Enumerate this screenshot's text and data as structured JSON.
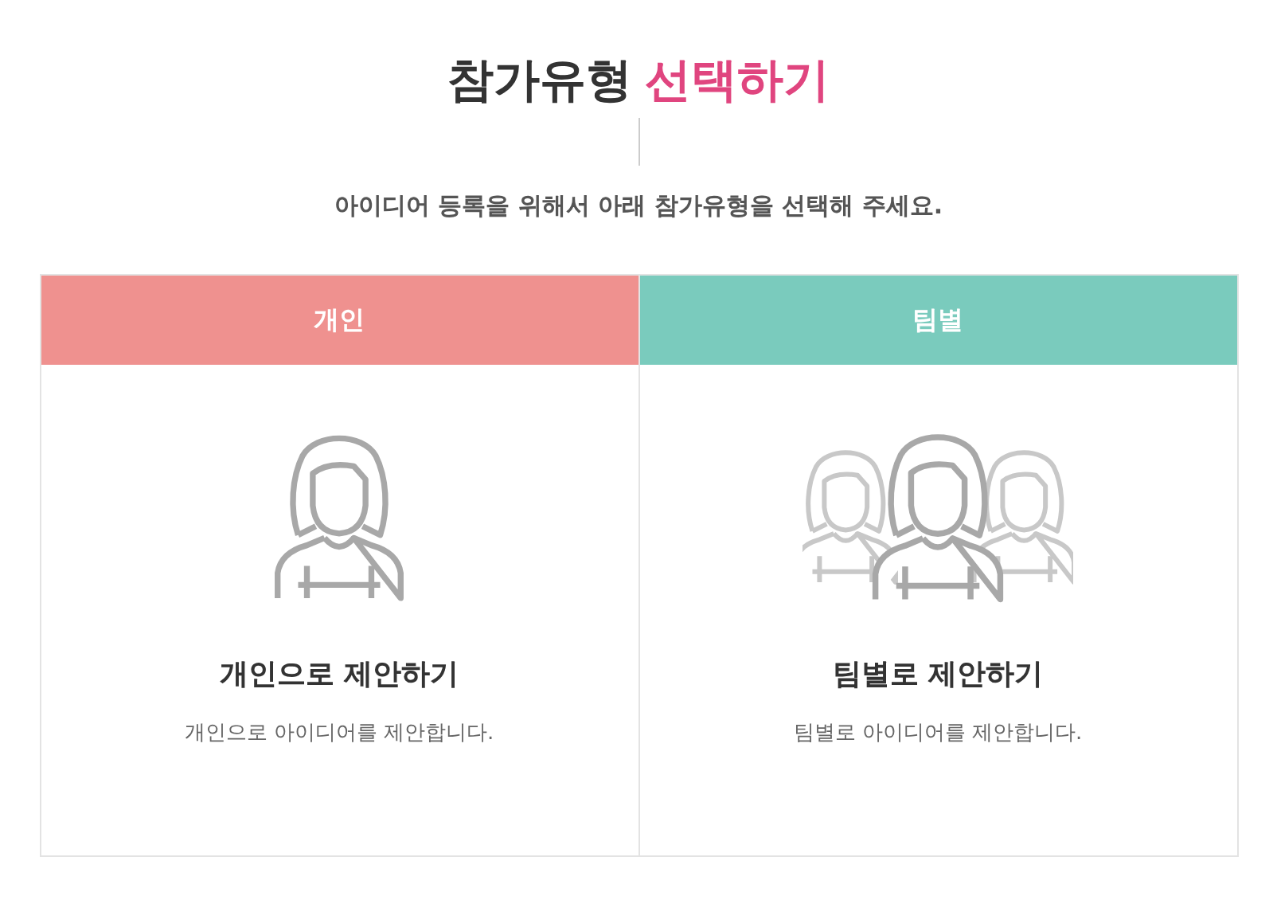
{
  "heading": {
    "text": "참가유형",
    "highlight": "선택하기"
  },
  "subtitle": "아이디어 등록을 위해서 아래 참가유형을 선택해 주세요.",
  "options": [
    {
      "kind": "single",
      "label": "개인",
      "color": "#ef918f",
      "title": "개인으로 제안하기",
      "description": "개인으로 아이디어를 제안합니다."
    },
    {
      "kind": "team",
      "label": "팀별",
      "color": "#7acbbd",
      "title": "팀별로 제안하기",
      "description": "팀별로 아이디어를 제안합니다."
    }
  ]
}
